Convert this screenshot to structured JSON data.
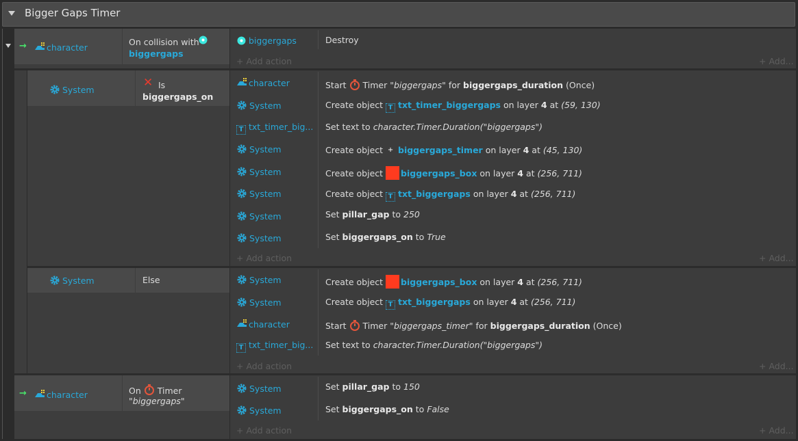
{
  "group": {
    "title": "Bigger Gaps Timer"
  },
  "add_action": "Add action",
  "add_more": "Add...",
  "event1": {
    "object": "character",
    "cond_text": "On collision with",
    "cond_target": "biggergaps",
    "actions": [
      {
        "object": "biggergaps",
        "text": "Destroy"
      }
    ]
  },
  "sub1": {
    "object": "System",
    "cond_prefix": "Is",
    "cond_var": "biggergaps_on",
    "actions": [
      {
        "object": "character",
        "p1": "Start",
        "p2": "Timer",
        "p3": "\"biggergaps\"",
        "p4": "for",
        "p5": "biggergaps_duration",
        "p6": "(Once)"
      },
      {
        "object": "System",
        "p1": "Create object",
        "p2": "txt_timer_biggergaps",
        "p3": "on layer",
        "p4": "4",
        "p5": "at",
        "p6": "(59, 130)"
      },
      {
        "object": "txt_timer_big...",
        "p1": "Set text to",
        "p2": "character.Timer.Duration(\"biggergaps\")"
      },
      {
        "object": "System",
        "p1": "Create object",
        "p2": "biggergaps_timer",
        "p3": "on layer",
        "p4": "4",
        "p5": "at",
        "p6": "(45, 130)"
      },
      {
        "object": "System",
        "p1": "Create object",
        "p2": "biggergaps_box",
        "p3": "on layer",
        "p4": "4",
        "p5": "at",
        "p6": "(256, 711)"
      },
      {
        "object": "System",
        "p1": "Create object",
        "p2": "txt_biggergaps",
        "p3": "on layer",
        "p4": "4",
        "p5": "at",
        "p6": "(256, 711)"
      },
      {
        "object": "System",
        "p1": "Set",
        "p2": "pillar_gap",
        "p3": "to",
        "p4": "250"
      },
      {
        "object": "System",
        "p1": "Set",
        "p2": "biggergaps_on",
        "p3": "to",
        "p4": "True"
      }
    ]
  },
  "sub2": {
    "object": "System",
    "cond_text": "Else",
    "actions": [
      {
        "object": "System",
        "p1": "Create object",
        "p2": "biggergaps_box",
        "p3": "on layer",
        "p4": "4",
        "p5": "at",
        "p6": "(256, 711)"
      },
      {
        "object": "System",
        "p1": "Create object",
        "p2": "txt_biggergaps",
        "p3": "on layer",
        "p4": "4",
        "p5": "at",
        "p6": "(256, 711)"
      },
      {
        "object": "character",
        "p1": "Start",
        "p2": "Timer",
        "p3": "\"biggergaps_timer\"",
        "p4": "for",
        "p5": "biggergaps_duration",
        "p6": "(Once)"
      },
      {
        "object": "txt_timer_big...",
        "p1": "Set text to",
        "p2": "character.Timer.Duration(\"biggergaps\")"
      }
    ]
  },
  "event3": {
    "object": "character",
    "cond_on": "On",
    "cond_timer": "Timer",
    "cond_name": "\"biggergaps\"",
    "actions": [
      {
        "object": "System",
        "p1": "Set",
        "p2": "pillar_gap",
        "p3": "to",
        "p4": "150"
      },
      {
        "object": "System",
        "p1": "Set",
        "p2": "biggergaps_on",
        "p3": "to",
        "p4": "False"
      }
    ]
  },
  "colors": {
    "link": "#29a9d9",
    "accent_red": "#ff3b1f",
    "green_arrow": "#49e36b"
  }
}
